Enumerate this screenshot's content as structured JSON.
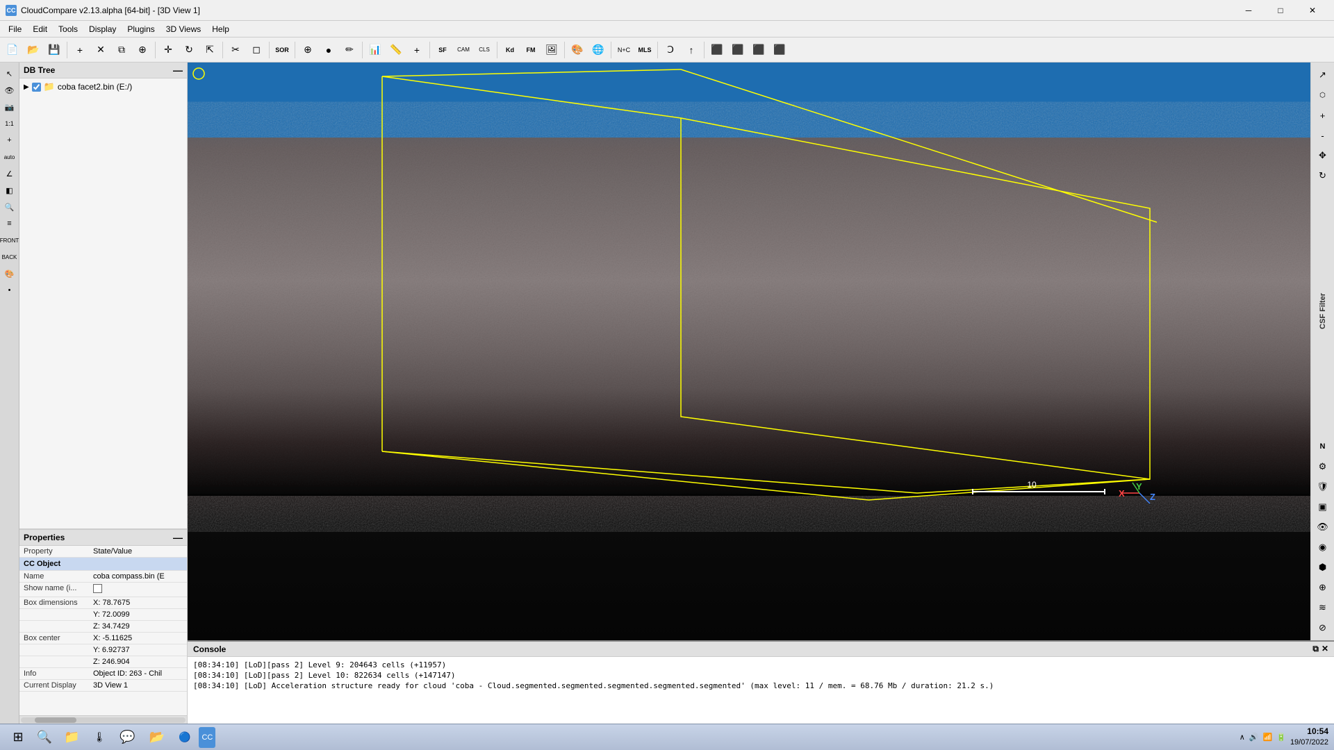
{
  "titlebar": {
    "icon_label": "CC",
    "title": "CloudCompare v2.13.alpha [64-bit] - [3D View 1]",
    "minimize": "─",
    "maximize": "□",
    "close": "✕"
  },
  "menubar": {
    "items": [
      "File",
      "Edit",
      "Tools",
      "Display",
      "Plugins",
      "3D Views",
      "Help"
    ]
  },
  "dbtree": {
    "title": "DB Tree",
    "items": [
      {
        "label": "coba facet2.bin (E:/)",
        "checked": true,
        "expanded": true
      }
    ]
  },
  "properties": {
    "title": "Properties",
    "columns": [
      "Property",
      "State/Value"
    ],
    "section": "CC Object",
    "rows": [
      {
        "prop": "Name",
        "value": "coba compass.bin (E"
      },
      {
        "prop": "Show name (i...",
        "value": "checkbox"
      },
      {
        "prop": "Box dimensions",
        "value_x": "X: 78.7675",
        "value_y": "Y: 72.0099",
        "value_z": "Z: 34.7429"
      },
      {
        "prop": "Box center",
        "value_x": "X: -5.11625",
        "value_y": "Y: 6.92737",
        "value_z": "Z: 246.904"
      },
      {
        "prop": "Info",
        "value": "Object ID: 263 - Chil"
      },
      {
        "prop": "Current Display",
        "value": "3D View 1"
      }
    ]
  },
  "console": {
    "title": "Console",
    "lines": [
      "[08:34:10] [LoD][pass 2] Level 9: 204643 cells (+11957)",
      "[08:34:10] [LoD][pass 2] Level 10: 822634 cells (+147147)",
      "[08:34:10] [LoD] Acceleration structure ready for cloud 'coba - Cloud.segmented.segmented.segmented.segmented.segmented' (max level: 11 / mem. = 68.76 Mb / duration: 21.2 s.)"
    ]
  },
  "viewport": {
    "scale_label": "10",
    "axes": {
      "x": "X",
      "y": "Y",
      "z": "Z"
    }
  },
  "right_sidebar": {
    "label": "CSF Filter",
    "icons": [
      "↗",
      "N",
      "⚙",
      "⬡",
      "▣",
      "◉",
      "◍",
      "⬢",
      "⊕",
      "≋",
      "⊘"
    ]
  },
  "taskbar": {
    "start_icon": "⊞",
    "search_icon": "🔍",
    "file_icon": "📁",
    "temp_icon": "🌡",
    "chat_icon": "💬",
    "folder_icon": "📂",
    "chrome_icon": "◉",
    "cc_icon": "CC",
    "time": "10:54",
    "date": "19/07/2022",
    "tray_icons": [
      "∧",
      "🔊",
      "📶",
      "🔋"
    ]
  }
}
